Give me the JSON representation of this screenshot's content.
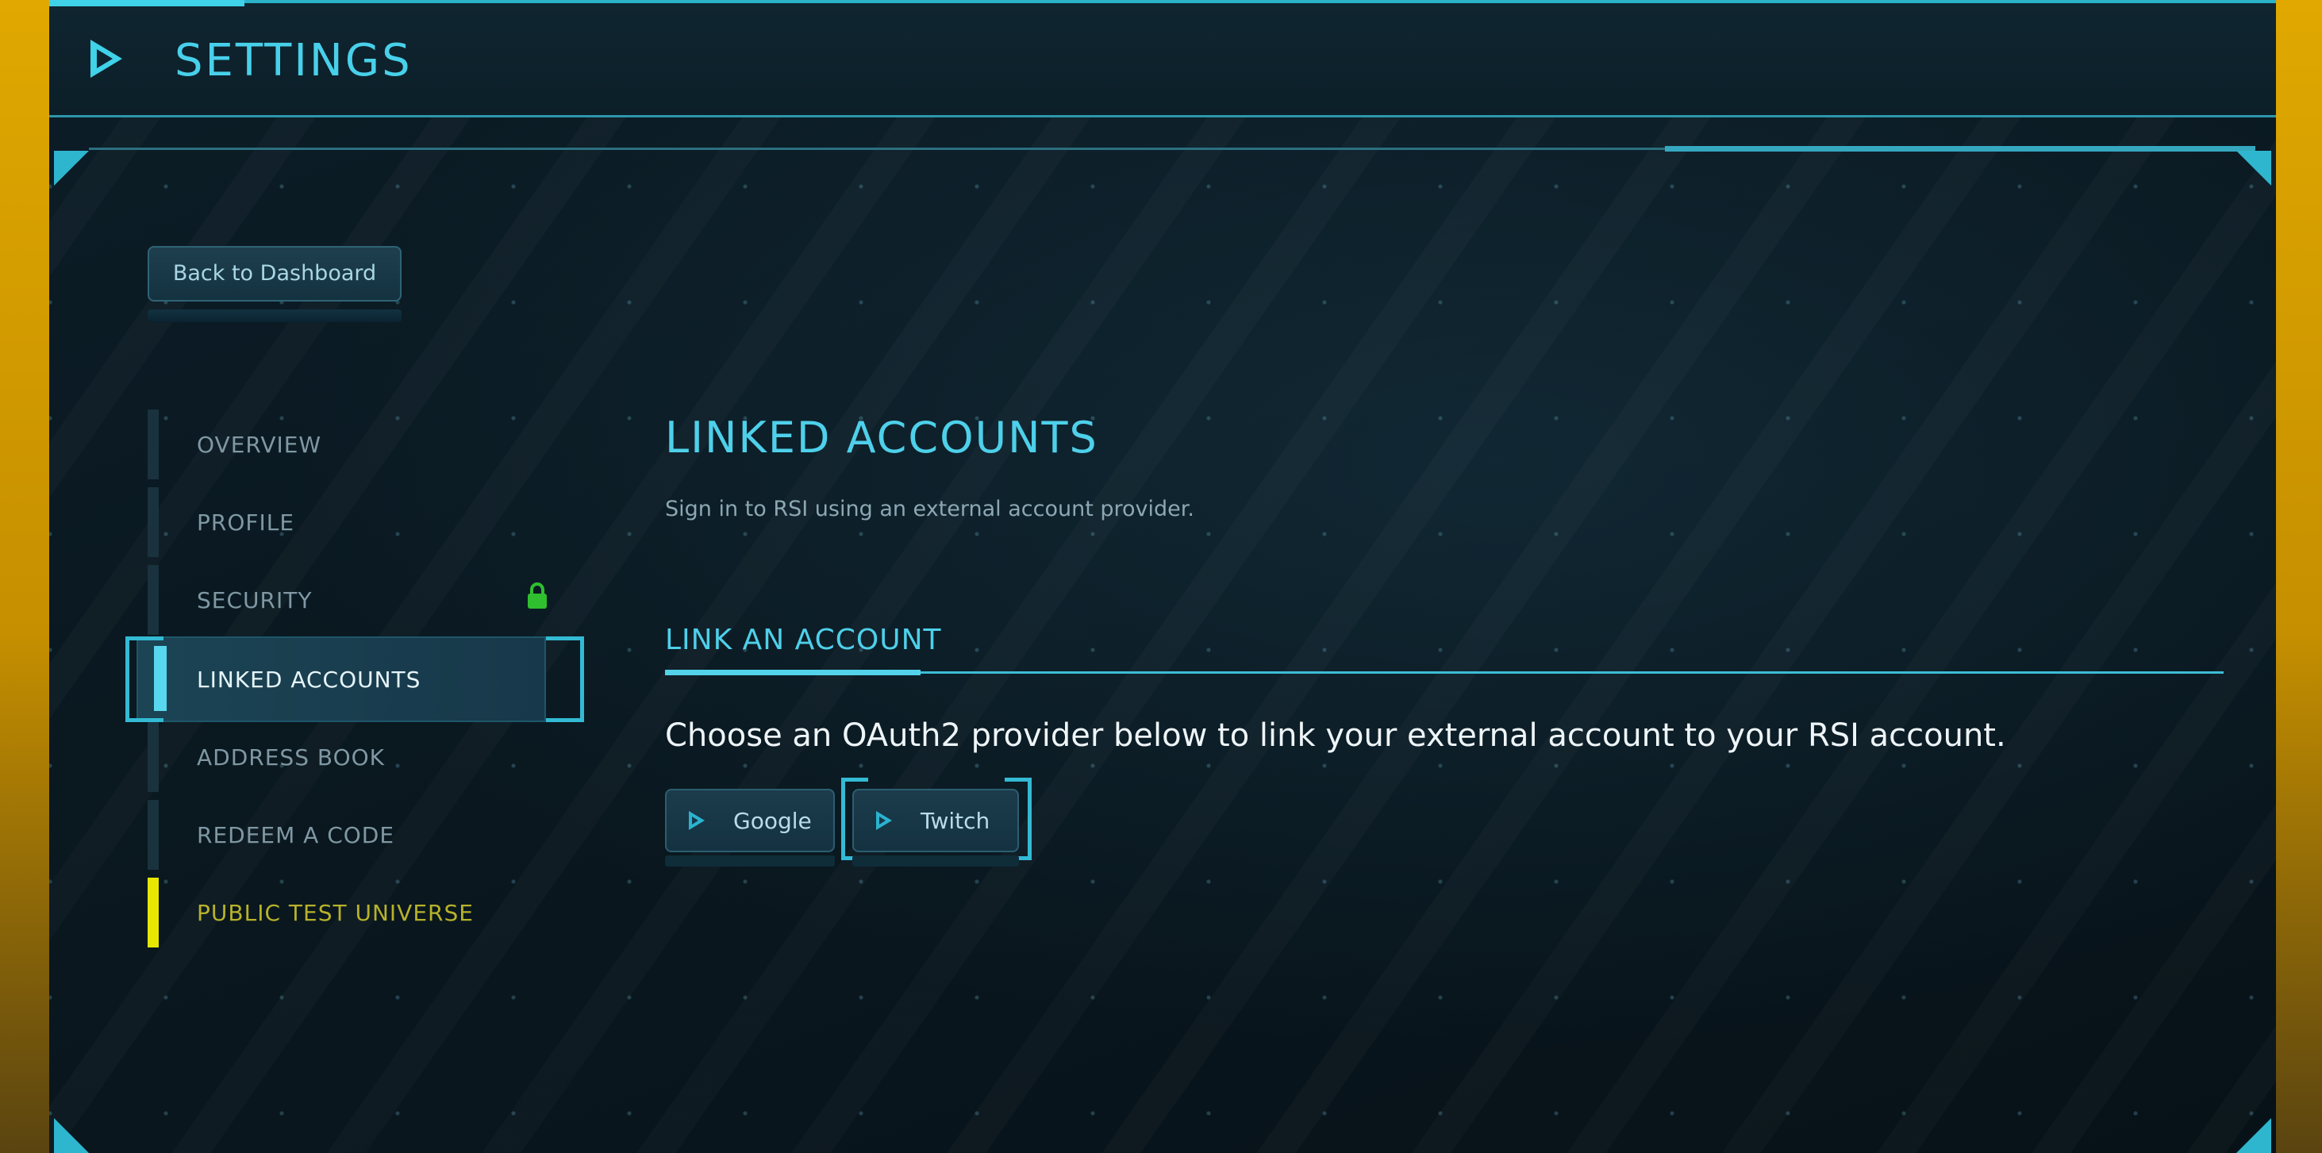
{
  "app": {
    "title": "SETTINGS"
  },
  "header": {
    "icon": "play-triangle-icon"
  },
  "back_button": {
    "label": "Back to Dashboard"
  },
  "nav": {
    "items": [
      {
        "label": "OVERVIEW",
        "active": false
      },
      {
        "label": "PROFILE",
        "active": false
      },
      {
        "label": "SECURITY",
        "active": false,
        "icon": "lock-icon"
      },
      {
        "label": "LINKED ACCOUNTS",
        "active": true
      },
      {
        "label": "ADDRESS BOOK",
        "active": false
      },
      {
        "label": "REDEEM A CODE",
        "active": false
      },
      {
        "label": "PUBLIC TEST UNIVERSE",
        "active": false
      }
    ]
  },
  "main": {
    "title": "LINKED ACCOUNTS",
    "description": "Sign in to RSI using an external account provider.",
    "section": {
      "title": "LINK AN ACCOUNT",
      "description": "Choose an OAuth2 provider below to link your external account to your RSI account.",
      "providers": [
        {
          "label": "Google",
          "icon": "play-icon",
          "selected": false
        },
        {
          "label": "Twitch",
          "icon": "play-icon",
          "selected": true
        }
      ]
    }
  },
  "colors": {
    "accent": "#48d0ea",
    "ptu": "#e6e600",
    "lock": "#2fbf2f",
    "outer_frame": "#e0a800"
  }
}
